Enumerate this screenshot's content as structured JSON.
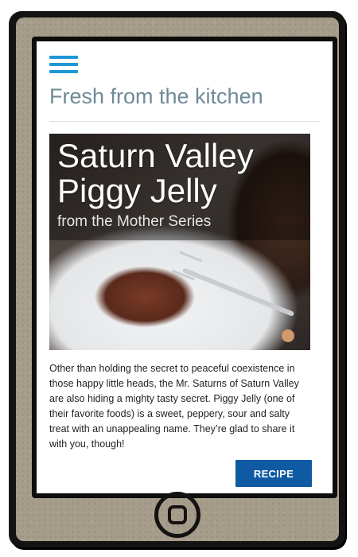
{
  "header": {
    "title": "Fresh from the kitchen",
    "menu_icon": "hamburger-menu-icon",
    "accent_color": "#1f97d4"
  },
  "hero": {
    "title": "Saturn Valley Piggy Jelly",
    "subtitle": "from the Mother Series"
  },
  "article": {
    "description": "Other than holding the secret to peaceful coexistence in those happy little heads, the Mr. Saturns of Saturn Valley are also hiding a mighty tasty secret. Piggy Jelly (one of their favorite foods) is a sweet, peppery, sour and salty treat with an unappealing name. They’re glad to share it with you, though!"
  },
  "actions": {
    "recipe_label": "RECIPE",
    "button_color": "#0f5aa3"
  },
  "device": {
    "home_icon": "home-button-icon"
  }
}
